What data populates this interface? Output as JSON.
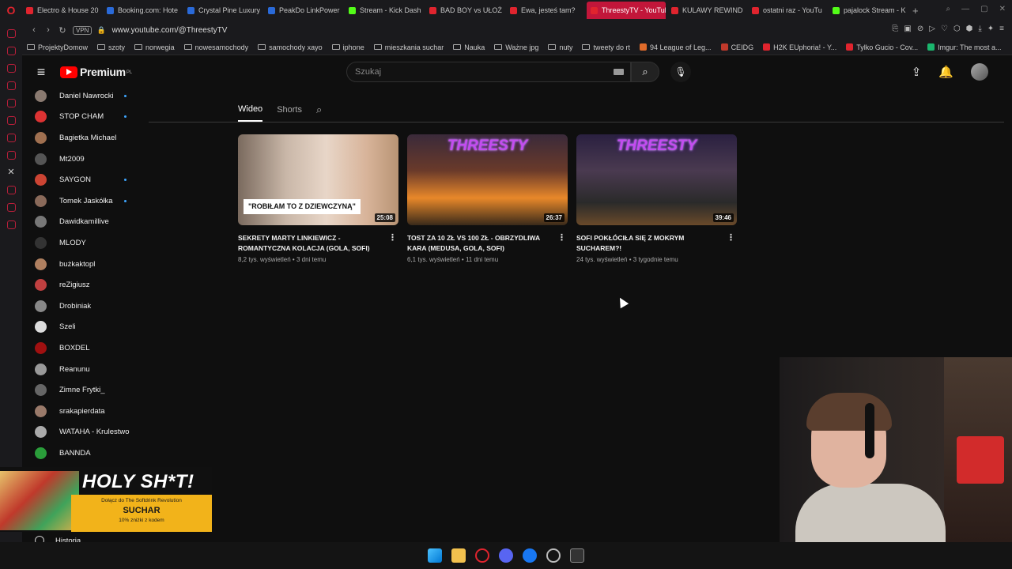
{
  "browser": {
    "tabs": [
      {
        "label": "Electro & House 20",
        "color": "#e0242e"
      },
      {
        "label": "Booking.com: Hote",
        "color": "#2a6ad9"
      },
      {
        "label": "Crystal Pine Luxury",
        "color": "#2a6ad9"
      },
      {
        "label": "PeakDo LinkPower",
        "color": "#2a6ad9"
      },
      {
        "label": "Stream - Kick Dash",
        "color": "#53fc18"
      },
      {
        "label": "BAD BOY vs UŁOŻ",
        "color": "#e0242e"
      },
      {
        "label": "Ewa, jesteś tam?",
        "color": "#e0242e"
      },
      {
        "label": "ThreestyTV - YouTube",
        "color": "#e0242e",
        "active": true
      },
      {
        "label": "KULAWY REWIND",
        "color": "#e0242e"
      },
      {
        "label": "ostatni raz - YouTu",
        "color": "#e0242e"
      },
      {
        "label": "pajalock Stream - K",
        "color": "#53fc18"
      }
    ],
    "vpn_label": "VPN",
    "url": "www.youtube.com/@ThreestyTV",
    "bookmarks": [
      {
        "label": "ProjektyDomow",
        "icon": "folder-icon"
      },
      {
        "label": "szoty",
        "icon": "folder-icon"
      },
      {
        "label": "norwegia",
        "icon": "folder-icon"
      },
      {
        "label": "nowesamochody",
        "icon": "folder-icon"
      },
      {
        "label": "samochody xayo",
        "icon": "folder-icon"
      },
      {
        "label": "iphone",
        "icon": "folder-icon"
      },
      {
        "label": "mieszkania suchar",
        "icon": "folder-icon"
      },
      {
        "label": "Nauka",
        "icon": "folder-icon"
      },
      {
        "label": "Ważne jpg",
        "icon": "folder-icon"
      },
      {
        "label": "nuty",
        "icon": "folder-icon"
      },
      {
        "label": "tweety do rt",
        "icon": "folder-icon"
      },
      {
        "label": "94 League of Leg...",
        "icon": "site-icon",
        "color": "#e06b2a"
      },
      {
        "label": "CEIDG",
        "icon": "site-icon",
        "color": "#c0392b"
      },
      {
        "label": "H2K EUphoria! - Y...",
        "icon": "site-icon",
        "color": "#e0242e"
      },
      {
        "label": "Tylko Gucio - Cov...",
        "icon": "site-icon",
        "color": "#e0242e"
      },
      {
        "label": "Imgur: The most a...",
        "icon": "site-icon",
        "color": "#1bb76e"
      }
    ]
  },
  "youtube": {
    "logo_text": "Premium",
    "logo_region": "PL",
    "search_placeholder": "Szukaj",
    "channel_tabs": [
      "Wideo",
      "Shorts"
    ],
    "sidebar": [
      {
        "name": "Daniel Nawrocki",
        "dot": true,
        "color": "#8a7a70"
      },
      {
        "name": "STOP CHAM",
        "dot": true,
        "color": "#d33"
      },
      {
        "name": "Bagietka Michael",
        "dot": false,
        "color": "#a07050"
      },
      {
        "name": "Mt2009",
        "dot": false,
        "color": "#555"
      },
      {
        "name": "SAYGON",
        "dot": true,
        "color": "#c43"
      },
      {
        "name": "Tomek Jaskółka",
        "dot": true,
        "color": "#8a6a5a"
      },
      {
        "name": "Dawidkamillive",
        "dot": false,
        "color": "#777"
      },
      {
        "name": "MLODY",
        "dot": false,
        "color": "#333"
      },
      {
        "name": "bużkaktopl",
        "dot": false,
        "color": "#b08060"
      },
      {
        "name": "reZigiusz",
        "dot": false,
        "color": "#c04040"
      },
      {
        "name": "Drobiniak",
        "dot": false,
        "color": "#888"
      },
      {
        "name": "Szeli",
        "dot": false,
        "color": "#ddd"
      },
      {
        "name": "BOXDEL",
        "dot": false,
        "color": "#a01010"
      },
      {
        "name": "Reanunu",
        "dot": false,
        "color": "#999"
      },
      {
        "name": "Zimne Frytki_",
        "dot": false,
        "color": "#666"
      },
      {
        "name": "srakapierdata",
        "dot": false,
        "color": "#9a7a6a"
      },
      {
        "name": "WATAHA - Krulestwo",
        "dot": false,
        "color": "#aaa"
      },
      {
        "name": "BANNDA",
        "dot": false,
        "color": "#2a9d3a"
      }
    ],
    "history_label": "Historia",
    "videos": [
      {
        "title": "SEKRETY MARTY LINKIEWICZ - ROMANTYCZNA KOLACJA (GOLA, SOFI)",
        "views": "8,2 tys. wyświetleń",
        "age": "3 dni temu",
        "duration": "25:08",
        "caption": "\"ROBIŁAM TO Z DZIEWCZYNĄ\"",
        "brand": ""
      },
      {
        "title": "TOST ZA 10 ZŁ VS 100 ZŁ - OBRZYDLIWA KARA (MEDUSA, GOLA, SOFI)",
        "views": "6,1 tys. wyświetleń",
        "age": "11 dni temu",
        "duration": "26:37",
        "caption": "",
        "brand": "THREESTY"
      },
      {
        "title": "SOFI POKŁÓCIŁA SIĘ Z MOKRYM SUCHAREM?!",
        "views": "24 tys. wyświetleń",
        "age": "3 tygodnie temu",
        "duration": "39:46",
        "caption": "",
        "brand": "THREESTY"
      }
    ]
  },
  "ad": {
    "headline": "HOLY SH*T!",
    "line1": "Dołącz do The Softdrink Revolution",
    "brand": "SUCHAR",
    "line2": "10% zniżki z kodem"
  }
}
